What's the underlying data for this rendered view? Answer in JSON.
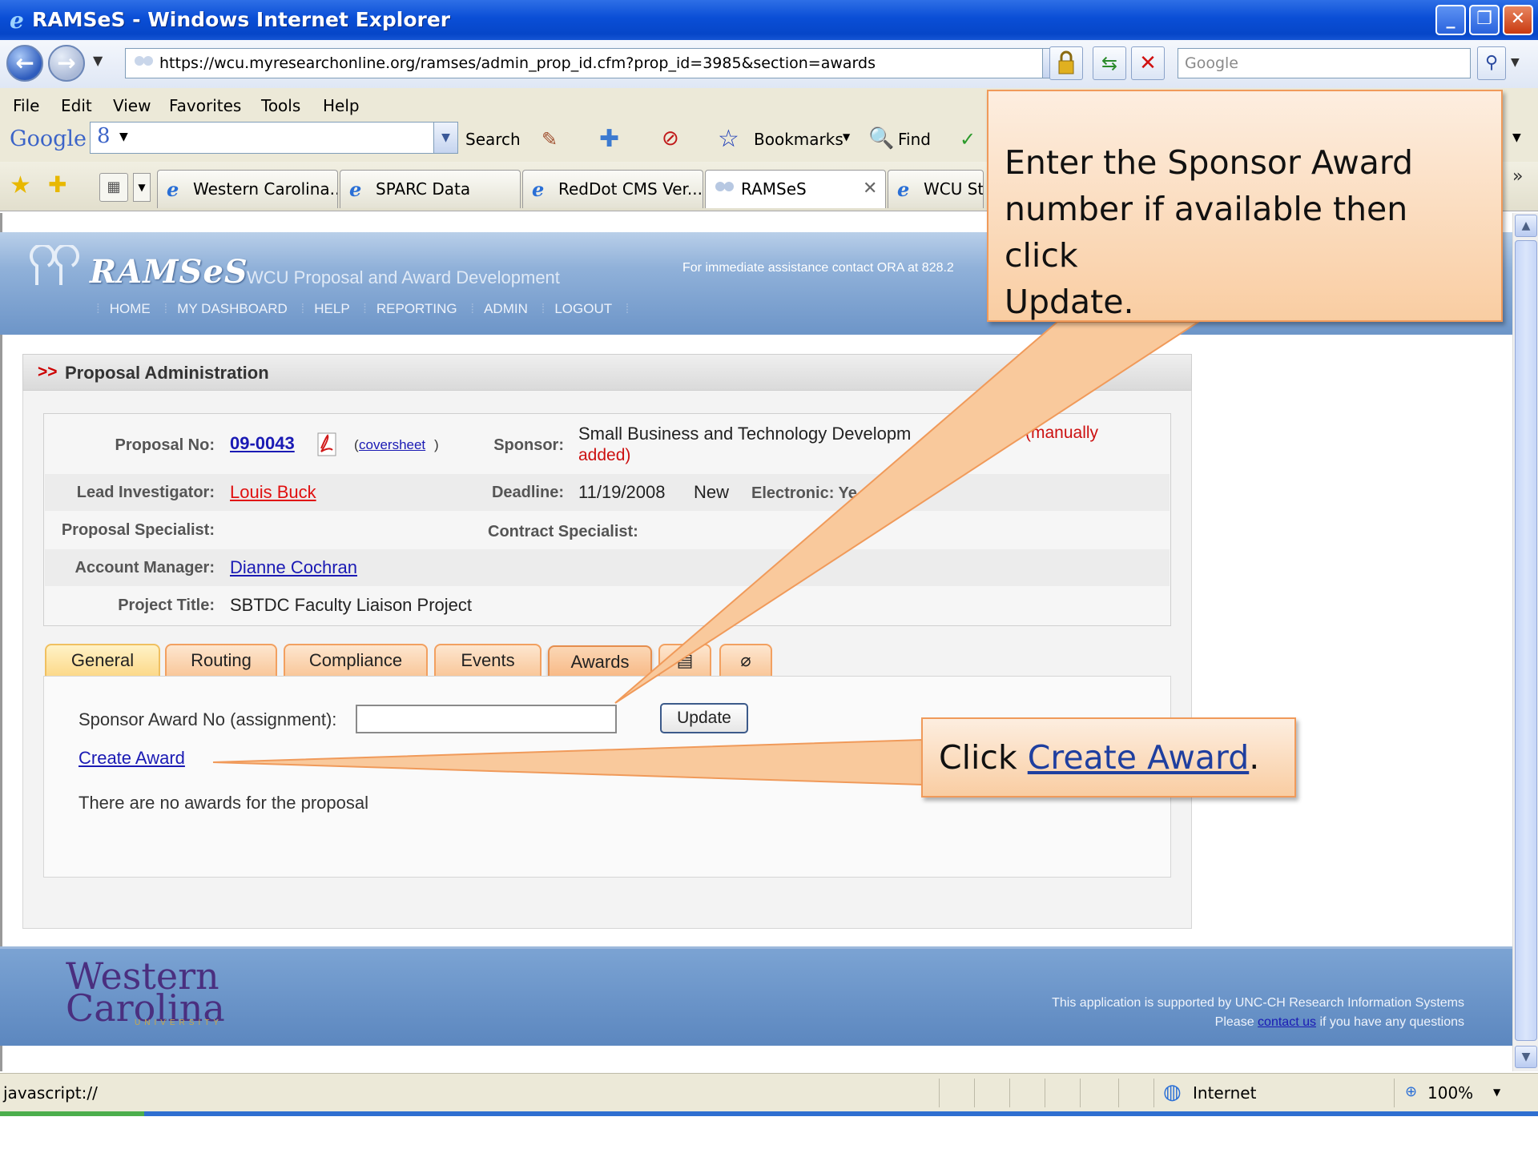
{
  "window": {
    "title": "RAMSeS - Windows Internet Explorer",
    "minimize_glyph": "_",
    "restore_glyph": "❐",
    "close_glyph": "✕"
  },
  "browser": {
    "address": "https://wcu.myresearchonline.org/ramses/admin_prop_id.cfm?prop_id=3985&section=awards",
    "search_placeholder": "Google",
    "menu": [
      "File",
      "Edit",
      "View",
      "Favorites",
      "Tools",
      "Help"
    ],
    "google_bar": {
      "logo": "Google",
      "g_icon": "8",
      "search_label": "Search",
      "bookmarks_label": "Bookmarks",
      "find_label": "Find"
    },
    "tabs": [
      {
        "label": "Western Carolina..."
      },
      {
        "label": "SPARC Data"
      },
      {
        "label": "RedDot CMS Ver..."
      },
      {
        "label": "RAMSeS"
      },
      {
        "label": "WCU Stu"
      }
    ],
    "status": {
      "text": "javascript://",
      "zone": "Internet",
      "zoom": "100%"
    }
  },
  "app": {
    "logo": "RAMSeS",
    "subtitle": "WCU Proposal and Award Development",
    "assist": "For immediate assistance contact ORA at 828.2",
    "nav": [
      "HOME",
      "MY DASHBOARD",
      "HELP",
      "REPORTING",
      "ADMIN",
      "LOGOUT"
    ],
    "panel_marker": ">>",
    "panel_title": "Proposal Administration",
    "proposal": {
      "proposal_no_label": "Proposal No:",
      "proposal_no": "09-0043",
      "coversheet": "coversheet",
      "sponsor_label": "Sponsor:",
      "sponsor_line1": "Small Business and Technology Developm",
      "sponsor_manual": "(manually",
      "sponsor_line2": "added)",
      "lead_label": "Lead Investigator:",
      "lead": "Louis Buck",
      "deadline_label": "Deadline:",
      "deadline": "11/19/2008",
      "new_label": "New",
      "electronic_label": "Electronic: Ye",
      "specialist_label": "Proposal Specialist:",
      "contract_label": "Contract Specialist:",
      "account_label": "Account Manager:",
      "account": "Dianne Cochran",
      "title_label": "Project Title:",
      "title": "SBTDC Faculty Liaison Project"
    },
    "tabs": [
      "General",
      "Routing",
      "Compliance",
      "Events",
      "Awards"
    ],
    "award_label": "Sponsor Award No (assignment):",
    "award_value": "",
    "update_label": "Update",
    "create_award": "Create Award",
    "no_awards": "There are no awards for the proposal",
    "footer": {
      "logo_line1": "Western",
      "logo_line2": "Carolina",
      "logo_line3": "UNIVERSITY",
      "support": "This application is supported by UNC-CH Research Information Systems",
      "please": "Please",
      "contact": "contact us",
      "questions": "if you have any questions"
    }
  },
  "callouts": {
    "c1_line1": "Enter the Sponsor Award",
    "c1_line2": "number if available then click",
    "c1_line3": "Update.",
    "c2_prefix": "Click",
    "c2_link": "Create Award",
    "c2_suffix": "."
  },
  "colors": {
    "callout_fill": "#f9cda2",
    "callout_border": "#f09a5a",
    "link_blue": "#1a1ab4",
    "link_red": "#e01010"
  }
}
